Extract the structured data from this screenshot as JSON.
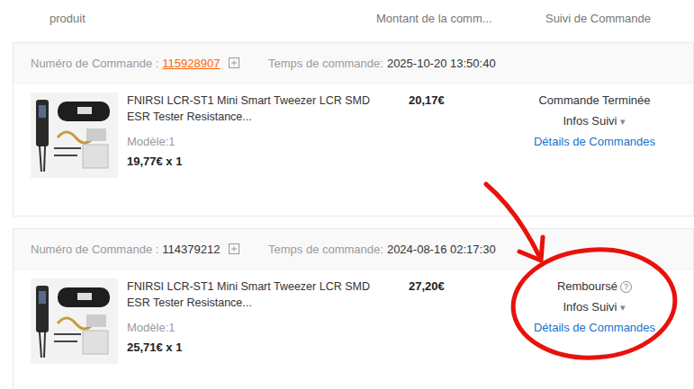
{
  "columns": [
    {
      "label": "produit"
    },
    {
      "label": "Montant de la comm..."
    },
    {
      "label": "Suivi de Commande"
    }
  ],
  "orders": [
    {
      "number_label": "Numéro de Commande :",
      "number": "115928907",
      "number_linked": true,
      "time_label": "Temps de commande:",
      "time": "2025-10-20 13:50:40",
      "product": {
        "title_lines": [
          "FNIRSI LCR-ST1 Mini Smart Tweezer LCR SMD",
          "ESR Tester Resistance..."
        ],
        "model": "Modèle:1",
        "price": "19,77€ x 1"
      },
      "amount": "20,17€",
      "status": "Commande Terminée",
      "status_help": "",
      "tracking": "Infos Suivi",
      "tracking_arrow": "▾",
      "details": "Détails de Commandes"
    },
    {
      "number_label": "Numéro de Commande :",
      "number": "114379212",
      "number_linked": false,
      "time_label": "Temps de commande:",
      "time": "2024-08-16 02:17:30",
      "product": {
        "title_lines": [
          "FNIRSI LCR-ST1 Mini Smart Tweezer LCR SMD",
          "ESR Tester Resistance..."
        ],
        "model": "Modèle:1",
        "price": "25,71€ x 1"
      },
      "amount": "27,20€",
      "status": "Remboursé",
      "status_help": "?",
      "tracking": "Infos Suivi",
      "tracking_arrow": "▾",
      "details": "Détails de Commandes"
    }
  ]
}
